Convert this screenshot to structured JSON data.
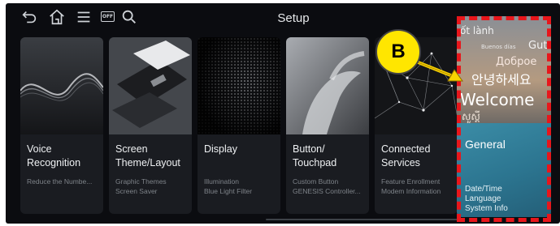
{
  "header": {
    "title": "Setup"
  },
  "icons": {
    "back": "back-arrow-icon",
    "home": "home-icon",
    "menu": "menu-icon",
    "screen_off": "OFF",
    "search": "search-icon"
  },
  "cards": [
    {
      "label": "Voice Recognition",
      "lines": [
        "Voice",
        "Recognition"
      ],
      "sub": [
        "Reduce the Numbe..."
      ]
    },
    {
      "label": "Screen Theme/Layout",
      "lines": [
        "Screen",
        "Theme/Layout"
      ],
      "sub": [
        "Graphic Themes",
        "Screen Saver"
      ]
    },
    {
      "label": "Display",
      "lines": [
        "Display",
        ""
      ],
      "sub": [
        "Illumination",
        "Blue Light Filter"
      ]
    },
    {
      "label": "Button/Touchpad",
      "lines": [
        "Button/",
        "Touchpad"
      ],
      "sub": [
        "Custom Button",
        "GENESIS Controller..."
      ]
    },
    {
      "label": "Connected Services",
      "lines": [
        "Connected",
        "Services"
      ],
      "sub": [
        "Feature Enrollment",
        "Modem Information"
      ]
    }
  ],
  "general_card": {
    "label": "General",
    "sub": [
      "Date/Time",
      "Language",
      "System Info"
    ],
    "image_words": [
      "ốt lành",
      "Buenos días",
      "Gut",
      "Доброе",
      "안녕하세요",
      "Welcome",
      "សួស្តី"
    ]
  },
  "callout": {
    "letter": "B"
  },
  "colors": {
    "annotation_red": "#e8161b",
    "callout_yellow": "#ffe600",
    "general_teal": "#2c7590"
  }
}
